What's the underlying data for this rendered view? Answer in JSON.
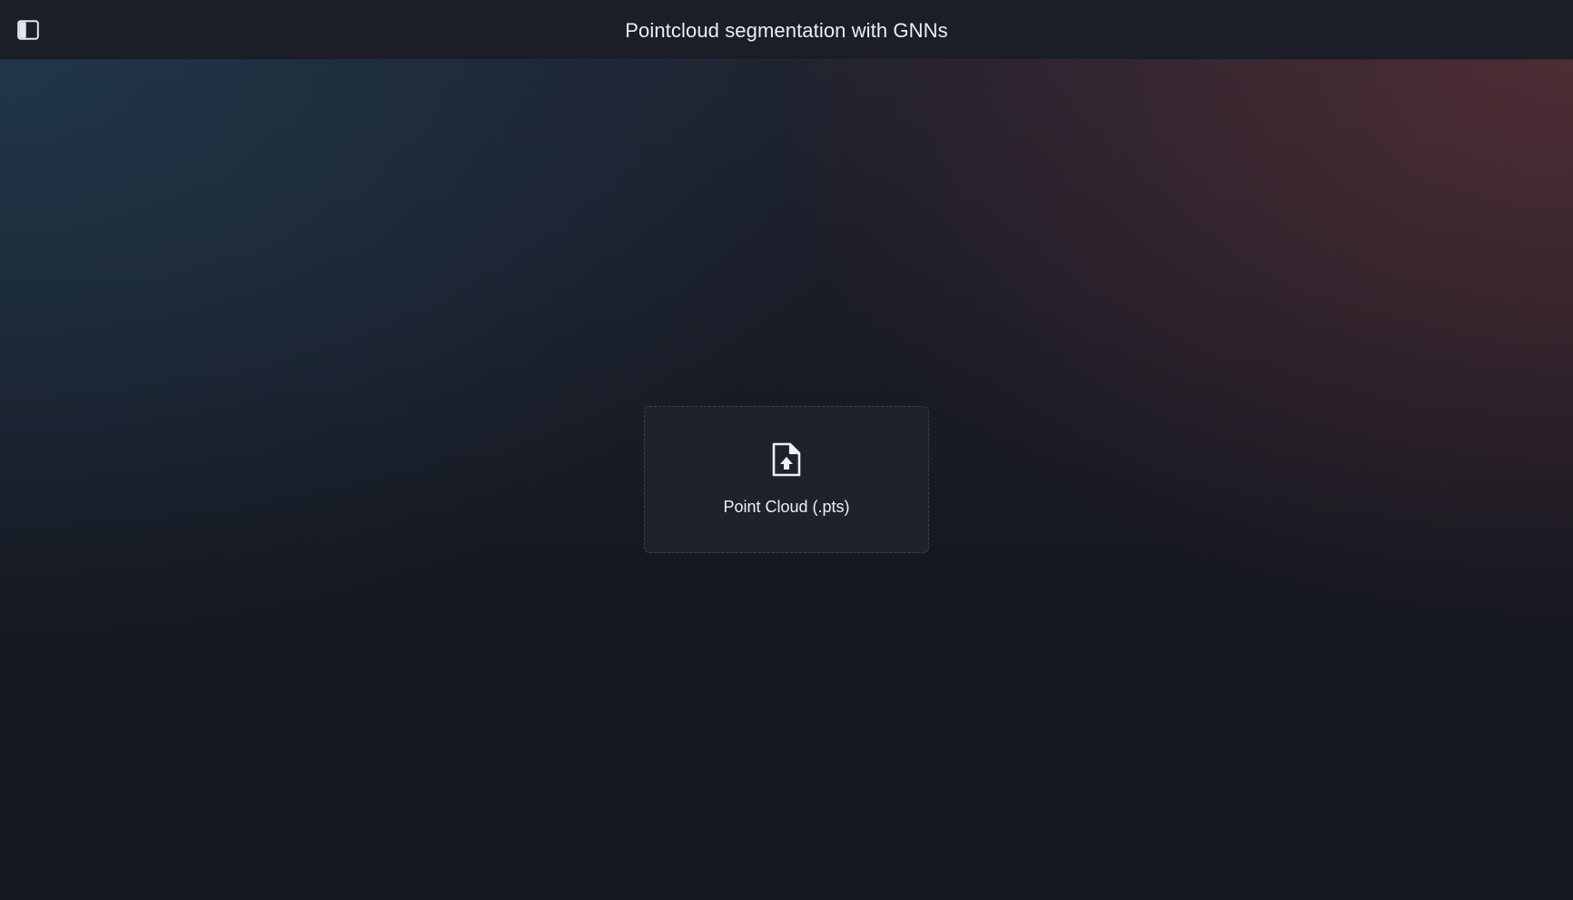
{
  "header": {
    "title": "Pointcloud segmentation with GNNs",
    "sidebar_toggle_icon": "sidebar-toggle-icon"
  },
  "upload": {
    "label": "Point Cloud (.pts)",
    "icon": "file-upload-icon"
  },
  "colors": {
    "background": "#161821",
    "topbar": "#1b1e27",
    "dropzone": "#1f222d",
    "dropzone_border": "#3a3f4d",
    "glow_left": "#203a4e",
    "glow_right": "#6e3438"
  }
}
